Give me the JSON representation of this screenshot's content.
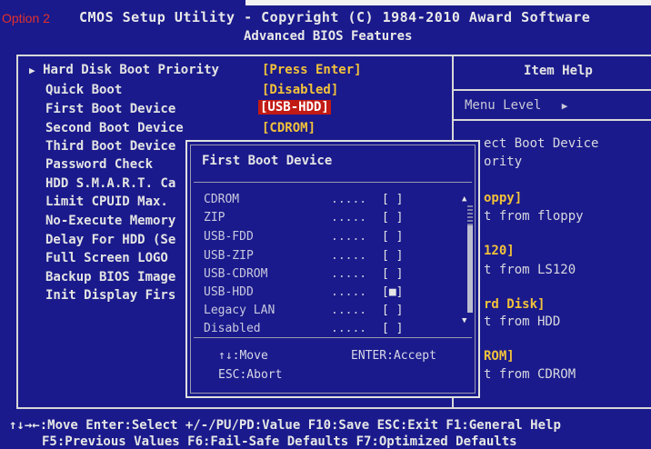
{
  "header": {
    "option_label": "Option 2",
    "title_line1": "CMOS Setup Utility - Copyright (C) 1984-2010 Award Software",
    "title_line2": "Advanced BIOS Features"
  },
  "settings": [
    {
      "label": "Hard Disk Boot Priority",
      "value": "[Press Enter]",
      "submenu": true
    },
    {
      "label": "Quick Boot",
      "value": "[Disabled]"
    },
    {
      "label": "First Boot Device",
      "value": "[USB-HDD]",
      "selected": true
    },
    {
      "label": "Second Boot Device",
      "value": "[CDROM]"
    },
    {
      "label": "Third Boot Device"
    },
    {
      "label": "Password Check"
    },
    {
      "label": "HDD S.M.A.R.T. Ca"
    },
    {
      "label": "Limit CPUID Max."
    },
    {
      "label": "No-Execute Memory"
    },
    {
      "label": "Delay For HDD (Se"
    },
    {
      "label": "Full Screen LOGO"
    },
    {
      "label": "Backup BIOS Image"
    },
    {
      "label": "Init Display Firs"
    }
  ],
  "help_panel": {
    "title": "Item Help",
    "menu_level": "Menu Level",
    "menu_level_marker": "▶",
    "lines": [
      {
        "text": "ect Boot Device",
        "style": "normal"
      },
      {
        "text": "ority",
        "style": "normal"
      },
      {
        "text": "oppy]",
        "style": "yellow"
      },
      {
        "text": "t from floppy",
        "style": "normal"
      },
      {
        "text": "120]",
        "style": "yellow"
      },
      {
        "text": "t from LS120",
        "style": "normal"
      },
      {
        "text": "rd Disk]",
        "style": "yellow"
      },
      {
        "text": "t from HDD",
        "style": "normal"
      },
      {
        "text": "ROM]",
        "style": "yellow"
      },
      {
        "text": "t from CDROM",
        "style": "normal"
      }
    ]
  },
  "popup": {
    "title": "First Boot Device",
    "options": [
      {
        "label": "CDROM",
        "dots": ".....",
        "box": "[ ]"
      },
      {
        "label": "ZIP",
        "dots": ".....",
        "box": "[ ]"
      },
      {
        "label": "USB-FDD",
        "dots": ".....",
        "box": "[ ]"
      },
      {
        "label": "USB-ZIP",
        "dots": ".....",
        "box": "[ ]"
      },
      {
        "label": "USB-CDROM",
        "dots": ".....",
        "box": "[ ]"
      },
      {
        "label": "USB-HDD",
        "dots": ".....",
        "box": "[■]"
      },
      {
        "label": "Legacy LAN",
        "dots": ".....",
        "box": "[ ]"
      },
      {
        "label": "Disabled",
        "dots": ".....",
        "box": "[ ]"
      }
    ],
    "hint_move": "↑↓:Move",
    "hint_accept": "ENTER:Accept",
    "hint_abort": "ESC:Abort"
  },
  "footer": {
    "line1": "↑↓→←:Move  Enter:Select  +/-/PU/PD:Value  F10:Save  ESC:Exit  F1:General Help",
    "line2": "F5:Previous Values  F6:Fail-Safe Defaults  F7:Optimized Defaults"
  },
  "colors": {
    "background": "#1a1a8c",
    "value_yellow": "#f2c23a",
    "highlight_red": "#c21a14",
    "option_label_red": "#e4312b"
  }
}
